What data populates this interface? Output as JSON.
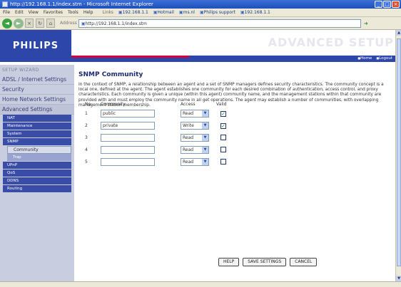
{
  "window": {
    "title": "http://192.168.1.1/index.stm - Microsoft Internet Explorer",
    "minimize": "_",
    "maximize": "□",
    "close": "×"
  },
  "menubar": {
    "items": [
      "File",
      "Edit",
      "View",
      "Favorites",
      "Tools",
      "Help"
    ],
    "links_label": "Links",
    "links": [
      "192.168.1.1",
      "Hotmail",
      "ms.nl",
      "Philips support",
      "192.168.1.1"
    ]
  },
  "toolbar": {
    "back": "◄",
    "forward": "►",
    "address_label": "Address",
    "address_value": "http://192.168.1.1/index.stm",
    "go": "Go"
  },
  "header": {
    "logo": "PHILIPS",
    "title": "ADVANCED SETUP",
    "home_link": "Home",
    "logout_link": "Logout"
  },
  "sidebar": {
    "heading": "SETUP WIZARD",
    "items": [
      {
        "label": "ADSL / Internet Settings"
      },
      {
        "label": "Security"
      },
      {
        "label": "Home Network Settings"
      },
      {
        "label": "Advanced Settings"
      }
    ],
    "subitems": [
      "NAT",
      "Maintenance",
      "System",
      "SNMP"
    ],
    "snmp_children": [
      "Community",
      "Trap"
    ],
    "more": [
      "UPnP",
      "QoS",
      "DDNS",
      "Routing"
    ]
  },
  "main": {
    "title": "SNMP Community",
    "description": "In the context of SNMP, a relationship between an agent and a set of SNMP managers defines security characteristics. The community concept is a local one, defined at the agent. The agent establishes one community for each desired combination of authentication, access control, and proxy characteristics. Each community is given a unique (within this agent) community name, and the management stations within that community are provided with and must employ the community name in all get operations. The agent may establish a number of communities, with overlapping management station membership."
  },
  "table": {
    "headers": {
      "no": "No.",
      "community": "Community",
      "access": "Access",
      "valid": "Valid"
    },
    "rows": [
      {
        "no": "1",
        "community": "public",
        "access": "Read",
        "valid": true
      },
      {
        "no": "2",
        "community": "private",
        "access": "Write",
        "valid": true
      },
      {
        "no": "3",
        "community": "",
        "access": "Read",
        "valid": false
      },
      {
        "no": "4",
        "community": "",
        "access": "Read",
        "valid": false
      },
      {
        "no": "5",
        "community": "",
        "access": "Read",
        "valid": false
      }
    ]
  },
  "buttons": {
    "help": "HELP",
    "save": "SAVE SETTINGS",
    "cancel": "CANCEL"
  },
  "colors": {
    "brand_blue": "#2c47a9",
    "accent_red": "#d8003a",
    "sidebar_bg": "#c9cde0",
    "title_text": "#1c2a72"
  }
}
